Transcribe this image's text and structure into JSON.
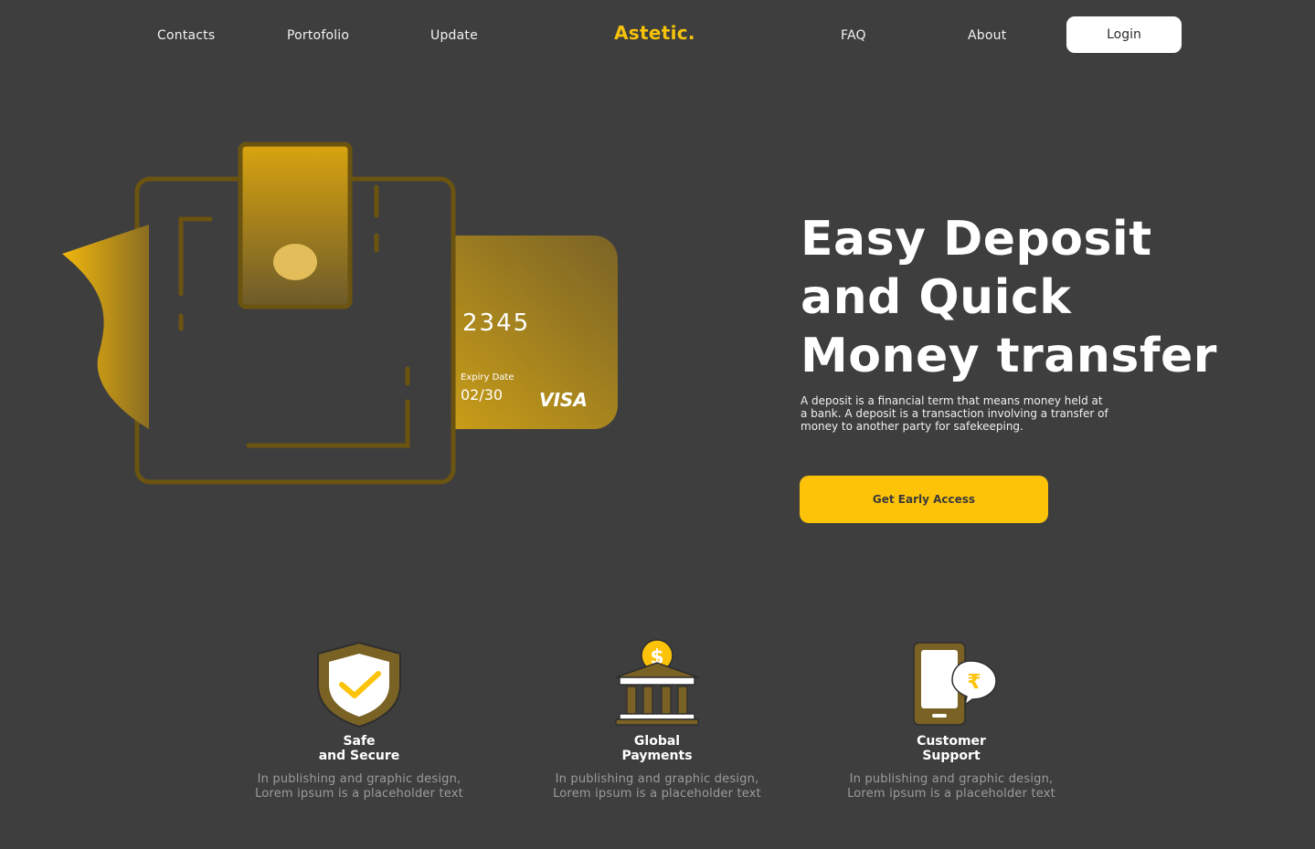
{
  "nav": {
    "left_links": [
      "Contacts",
      "Portofolio",
      "Update"
    ],
    "brand": "Astetic.",
    "right_links": [
      "FAQ",
      "About"
    ],
    "login_label": "Login"
  },
  "card": {
    "number": "2345",
    "expiry_label": "Expiry Date",
    "expiry_value": "02/30",
    "network": "VISA"
  },
  "hero": {
    "title_line1": "Easy Deposit",
    "title_line2": "and Quick",
    "title_line3": "Money transfer",
    "description_line1": "A deposit is a financial term that means money held at",
    "description_line2": "a bank. A deposit is a transaction involving a transfer of",
    "description_line3": "money to another party for safekeeping.",
    "cta_label": "Get Early Access"
  },
  "features": [
    {
      "icon": "shield-check-icon",
      "title_line1": "Safe",
      "title_line2": "and Secure",
      "desc_line1": "In publishing and graphic design,",
      "desc_line2": "Lorem ipsum is a placeholder text"
    },
    {
      "icon": "bank-dollar-icon",
      "title_line1": "Global",
      "title_line2": "Payments",
      "desc_line1": "In publishing and graphic design,",
      "desc_line2": "Lorem ipsum is a placeholder text"
    },
    {
      "icon": "phone-rupee-chat-icon",
      "title_line1": "Customer",
      "title_line2": "Support",
      "desc_line1": "In publishing and graphic design,",
      "desc_line2": "Lorem ipsum is a placeholder text"
    }
  ],
  "colors": {
    "background": "#3e3e3e",
    "accent": "#fcc309",
    "brand": "#f5c20a",
    "wallet_outline": "#6b5310",
    "icon_brown": "#7a6225"
  }
}
